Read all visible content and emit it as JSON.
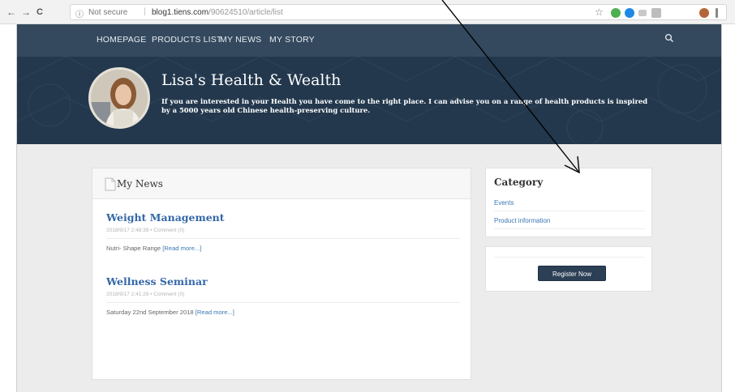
{
  "browser": {
    "back_glyph": "←",
    "forward_glyph": "→",
    "reload_glyph": "C",
    "info_glyph": "ⓘ",
    "security_text": "Not secure",
    "separator": "|",
    "url_domain": "blog1.tiens.com",
    "url_path": "/90624510/article/list",
    "star_glyph": "☆"
  },
  "site": {
    "nav": [
      {
        "label": "HOMEPAGE"
      },
      {
        "label": "PRODUCTS LIST"
      },
      {
        "label": "MY NEWS"
      },
      {
        "label": "MY STORY"
      }
    ],
    "hero": {
      "title": "Lisa's Health & Wealth",
      "description": "If you are interested in your Health you have come to the right place. I can advise you on a range of health products is inspired by a 5000 years old Chinese health-preserving culture."
    },
    "news": {
      "header": "My News",
      "articles": [
        {
          "title": "Weight Management",
          "meta": "2018/9/17 2:48:39 • Comment (0)",
          "body": "Nutri- Shape Range",
          "read_more": "[Read more...]"
        },
        {
          "title": "Wellness Seminar",
          "meta": "2018/9/17 2:41:29 • Comment (0)",
          "body": "Saturday 22nd September 2018",
          "read_more": "[Read more...]"
        }
      ]
    },
    "category": {
      "title": "Category",
      "items": [
        {
          "label": "Events"
        },
        {
          "label": "Product information"
        }
      ]
    },
    "register_button": "Register Now"
  },
  "colors": {
    "nav_bg": "#34495e",
    "hero_bg": "#23384d",
    "link": "#3467a8",
    "button_bg": "#2b3f55"
  }
}
